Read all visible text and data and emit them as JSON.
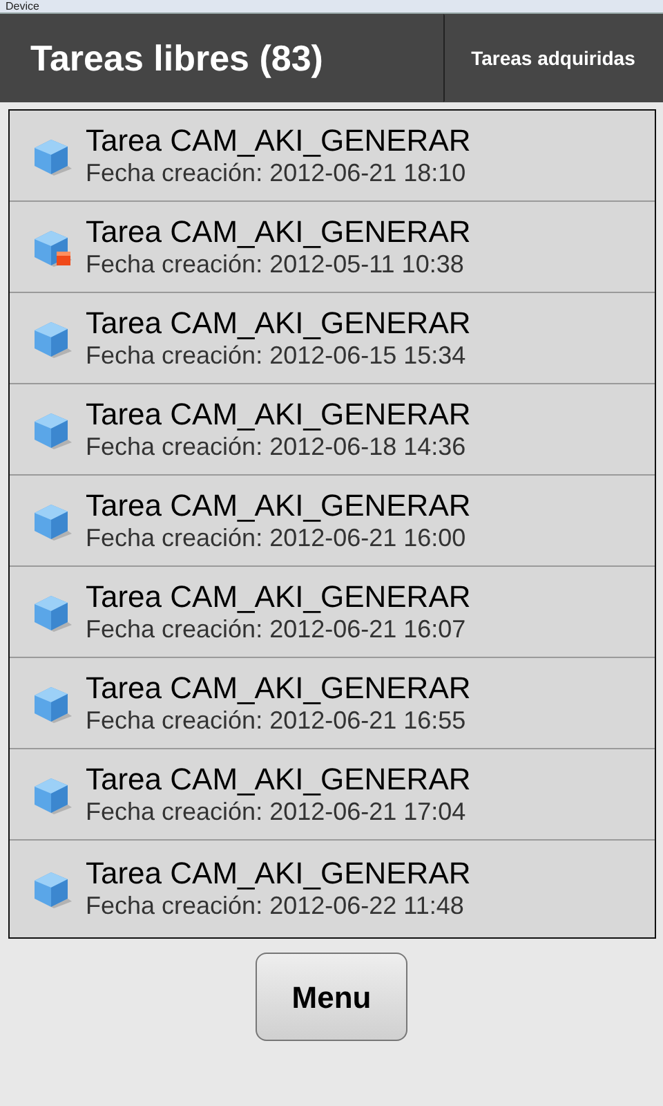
{
  "window": {
    "title": "Device"
  },
  "header": {
    "title": "Tareas libres (83)",
    "tab": "Tareas adquiridas"
  },
  "tasks": [
    {
      "name": "Tarea CAM_AKI_GENERAR",
      "date": "Fecha creación: 2012-06-21 18:10",
      "flagged": false
    },
    {
      "name": "Tarea CAM_AKI_GENERAR",
      "date": "Fecha creación: 2012-05-11 10:38",
      "flagged": true
    },
    {
      "name": "Tarea CAM_AKI_GENERAR",
      "date": "Fecha creación: 2012-06-15 15:34",
      "flagged": false
    },
    {
      "name": "Tarea CAM_AKI_GENERAR",
      "date": "Fecha creación: 2012-06-18 14:36",
      "flagged": false
    },
    {
      "name": "Tarea CAM_AKI_GENERAR",
      "date": "Fecha creación: 2012-06-21 16:00",
      "flagged": false
    },
    {
      "name": "Tarea CAM_AKI_GENERAR",
      "date": "Fecha creación: 2012-06-21 16:07",
      "flagged": false
    },
    {
      "name": "Tarea CAM_AKI_GENERAR",
      "date": "Fecha creación: 2012-06-21 16:55",
      "flagged": false
    },
    {
      "name": "Tarea CAM_AKI_GENERAR",
      "date": "Fecha creación: 2012-06-21 17:04",
      "flagged": false
    },
    {
      "name": "Tarea CAM_AKI_GENERAR",
      "date": "Fecha creación: 2012-06-22 11:48",
      "flagged": false
    }
  ],
  "buttons": [
    "Menu"
  ]
}
